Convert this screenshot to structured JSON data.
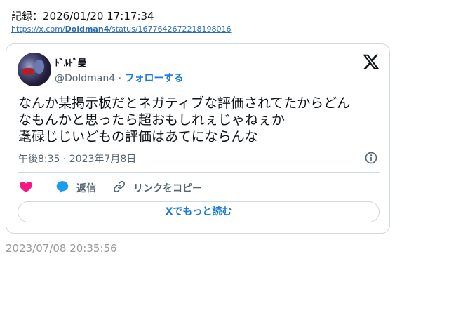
{
  "record": {
    "label": "記録：2026/01/20 17:17:34",
    "url_prefix": "https://x.com/",
    "url_user": "Doldman4",
    "url_suffix": "/status/1677642672218198016"
  },
  "tweet": {
    "display_name": "ﾄﾞﾙﾄﾞ曼",
    "handle": "@Doldman4",
    "separator": " · ",
    "follow_label": "フォローする",
    "text_lines": [
      "なんか某掲示板だとネガティブな評価されてたからどん",
      "なもんかと思ったら超おもしれぇじゃねぇか",
      "耄碌じじいどもの評価はあてにならんな"
    ],
    "timestamp": "午後8:35 · 2023年7月8日",
    "reply_label": "返信",
    "copy_link_label": "リンクをコピー",
    "read_more_label": "Xでもっと読む"
  },
  "saved_time": "2023/07/08 20:35:56",
  "colors": {
    "accent": "#1d7bd7",
    "heart": "#f91880",
    "muted": "#536471",
    "border": "#cfd9de"
  },
  "icons": {
    "brand": "x-logo-icon",
    "like": "heart-icon",
    "reply": "speech-bubble-icon",
    "copy": "link-icon",
    "info": "info-icon"
  }
}
